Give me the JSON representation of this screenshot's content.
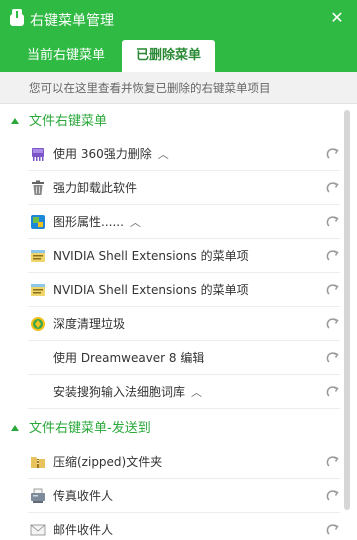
{
  "window": {
    "title": "右键菜单管理",
    "close_glyph": "✕",
    "accent_color": "#2fba43"
  },
  "tabs": [
    {
      "label": "当前右键菜单",
      "active": false
    },
    {
      "label": "已删除菜单",
      "active": true
    }
  ],
  "hint": "您可以在这里查看并恢复已删除的右键菜单项目",
  "sections": [
    {
      "title": "文件右键菜单",
      "items": [
        {
          "label": "使用 360强力删除",
          "has_caret": true,
          "icon": "shred-icon"
        },
        {
          "label": "强力卸载此软件",
          "has_caret": false,
          "icon": "trash-icon"
        },
        {
          "label": "图形属性......",
          "has_caret": true,
          "icon": "graphics-icon"
        },
        {
          "label": "NVIDIA Shell Extensions 的菜单项",
          "has_caret": false,
          "icon": "nvidia-icon"
        },
        {
          "label": "NVIDIA Shell Extensions 的菜单项",
          "has_caret": false,
          "icon": "nvidia-icon"
        },
        {
          "label": "深度清理垃圾",
          "has_caret": false,
          "icon": "cleaner-icon"
        },
        {
          "label": "使用 Dreamweaver 8 编辑",
          "has_caret": false,
          "icon": ""
        },
        {
          "label": "安装搜狗输入法细胞词库",
          "has_caret": true,
          "icon": ""
        }
      ]
    },
    {
      "title": "文件右键菜单-发送到",
      "items": [
        {
          "label": "压缩(zipped)文件夹",
          "has_caret": false,
          "icon": "zip-folder-icon"
        },
        {
          "label": "传真收件人",
          "has_caret": false,
          "icon": "fax-icon"
        },
        {
          "label": "邮件收件人",
          "has_caret": false,
          "icon": "mail-icon"
        }
      ]
    }
  ],
  "caret_glyph": "︿"
}
